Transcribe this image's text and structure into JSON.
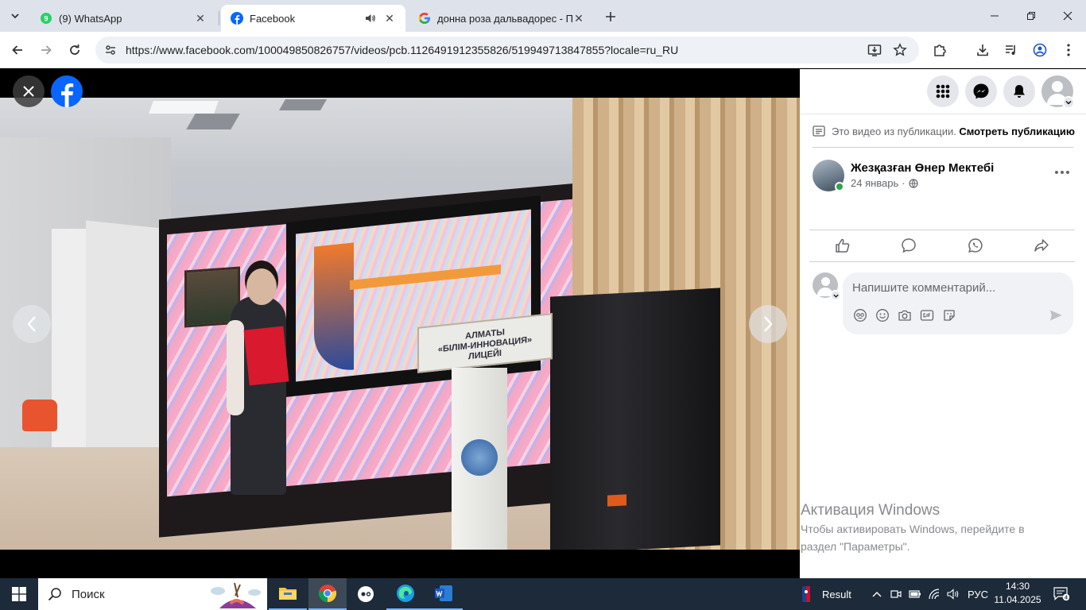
{
  "browser": {
    "tabs": [
      {
        "title": "(9) WhatsApp",
        "icon": "whatsapp-icon",
        "active": false
      },
      {
        "title": "Facebook",
        "icon": "facebook-icon",
        "active": true
      },
      {
        "title": "донна роза дальвадорес - По",
        "icon": "google-icon",
        "active": false
      }
    ],
    "url": "https://www.facebook.com/100049850826757/videos/pcb.1126491912355826/519949713847855?locale=ru_RU"
  },
  "video": {
    "podium_lines": [
      "АЛМАТЫ",
      "«БІЛІМ-ИННОВАЦИЯ»",
      "ЛИЦЕЙІ"
    ]
  },
  "sidebar": {
    "pub_note": "Это видео из публикации.",
    "pub_link": "Смотреть публикацию",
    "page_name": "Жезқазған Өнер Мектебі",
    "post_date": "24 январь",
    "post_date_sep": "·",
    "comment_placeholder": "Напишите комментарий..."
  },
  "watermark": {
    "title": "Активация Windows",
    "line1": "Чтобы активировать Windows, перейдите в",
    "line2": "раздел \"Параметры\"."
  },
  "taskbar": {
    "search_label": "Поиск",
    "nba_label": "Result",
    "lang": "РУС",
    "time": "14:30",
    "date": "11.04.2025",
    "notifications": "4"
  },
  "colors": {
    "facebook_blue": "#0866ff",
    "whatsapp_green": "#25d366",
    "online_green": "#31a24c"
  }
}
